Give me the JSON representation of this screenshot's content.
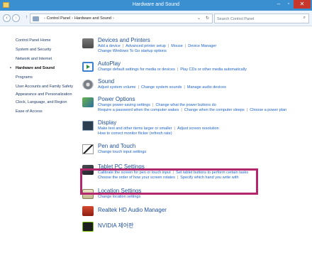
{
  "window": {
    "title": "Hardware and Sound",
    "minimize": "–",
    "maximize": "▫",
    "close": "✕"
  },
  "address": {
    "back": "‹",
    "forward": "›",
    "up": "↑",
    "dropdown": "⌄",
    "refresh": "↻",
    "crumbs": [
      "Control Panel",
      "Hardware and Sound"
    ],
    "search_placeholder": "Search Control Panel",
    "search_icon": "⌕"
  },
  "sidebar": {
    "items": [
      "Control Panel Home",
      "System and Security",
      "Network and Internet",
      "Hardware and Sound",
      "Programs",
      "User Accounts and Family Safety",
      "Appearance and Personalization",
      "Clock, Language, and Region",
      "Ease of Access"
    ],
    "current": "Hardware and Sound"
  },
  "categories": [
    {
      "icon": "printer-icon",
      "title": "Devices and Printers",
      "lines": [
        [
          "Add a device",
          "Advanced printer setup",
          "Mouse",
          "Device Manager"
        ],
        [
          "Change Windows To Go startup options"
        ]
      ]
    },
    {
      "icon": "autoplay-icon",
      "title": "AutoPlay",
      "lines": [
        [
          "Change default settings for media or devices",
          "Play CDs or other media automatically"
        ]
      ]
    },
    {
      "icon": "speaker-icon",
      "title": "Sound",
      "lines": [
        [
          "Adjust system volume",
          "Change system sounds",
          "Manage audio devices"
        ]
      ]
    },
    {
      "icon": "battery-icon",
      "title": "Power Options",
      "lines": [
        [
          "Change power-saving settings",
          "Change what the power buttons do"
        ],
        [
          "Require a password when the computer wakes",
          "Change when the computer sleeps",
          "Choose a power plan"
        ]
      ]
    },
    {
      "icon": "monitor-icon",
      "title": "Display",
      "lines": [
        [
          "Make text and other items larger or smaller",
          "Adjust screen resolution"
        ],
        [
          "How to correct monitor flicker (refresh rate)"
        ]
      ]
    },
    {
      "icon": "pen-icon",
      "title": "Pen and Touch",
      "lines": [
        [
          "Change touch input settings"
        ]
      ]
    },
    {
      "icon": "tablet-icon",
      "title": "Tablet PC Settings",
      "lines": [
        [
          "Calibrate the screen for pen or touch input",
          "Set tablet buttons to perform certain tasks"
        ],
        [
          "Choose the order of how your screen rotates",
          "Specify which hand you write with"
        ]
      ]
    },
    {
      "icon": "location-icon",
      "title": "Location Settings",
      "lines": [
        [
          "Change location settings"
        ]
      ]
    },
    {
      "icon": "realtek-icon",
      "title": "Realtek HD Audio Manager",
      "lines": []
    },
    {
      "icon": "nvidia-icon",
      "title": "NVIDIA 제어판",
      "lines": []
    }
  ],
  "colors": {
    "accent": "#3a8fd0",
    "link": "#1e63c8",
    "highlight": "#b3286c",
    "close": "#c7372c"
  }
}
